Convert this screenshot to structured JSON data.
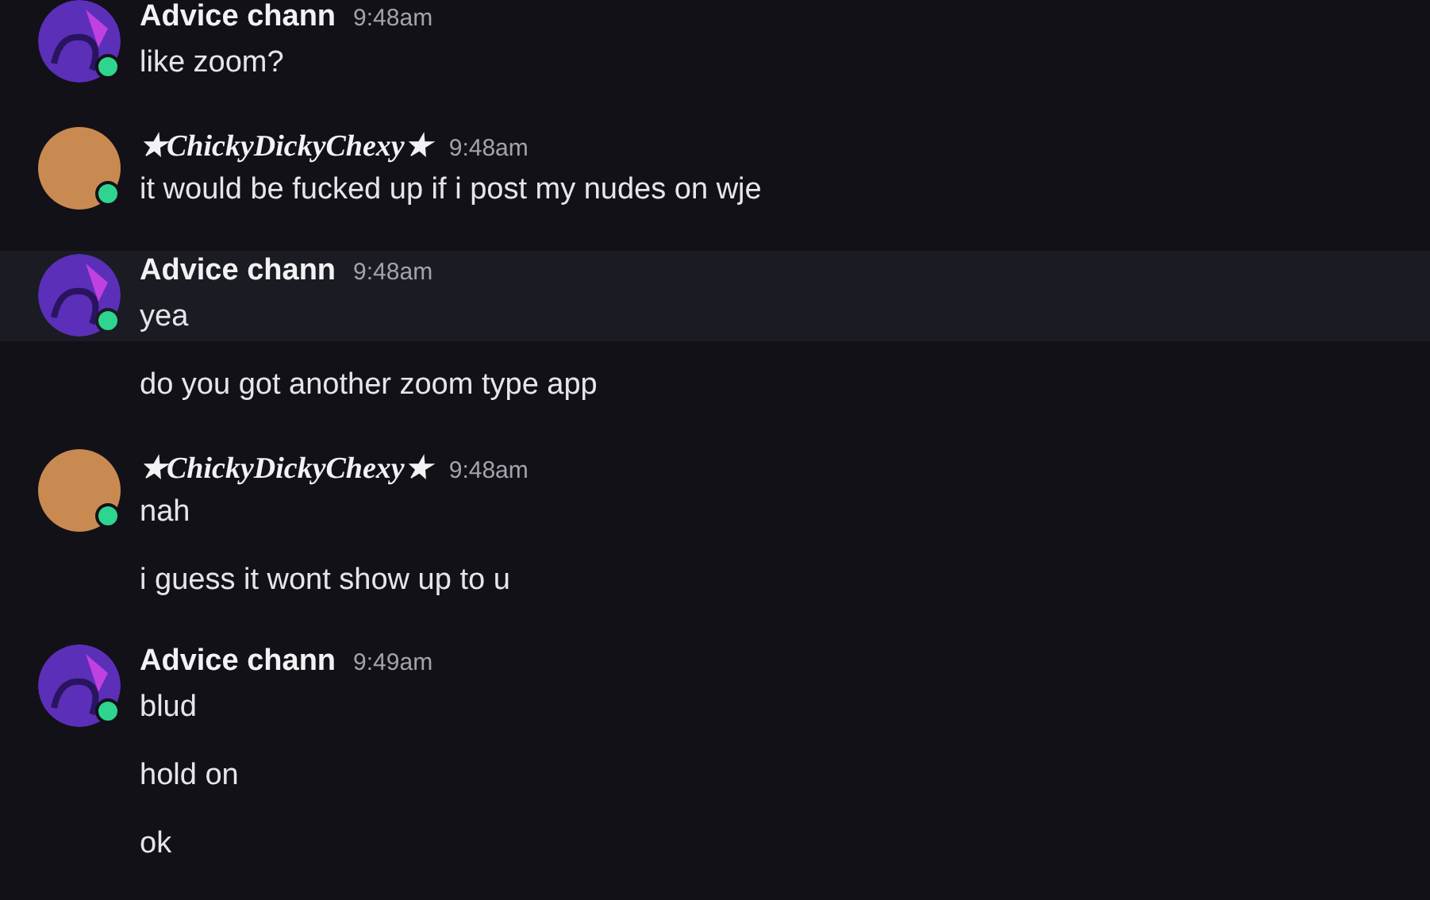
{
  "groups": [
    {
      "author": {
        "text": "Advice chann",
        "kind": "plain"
      },
      "avatar": {
        "kind": "drawing"
      },
      "online": true,
      "time": "9:48am",
      "messages": [
        {
          "text": "like zoom?",
          "highlighted": false
        }
      ]
    },
    {
      "author": {
        "text": "★ChickyDickyChexy★",
        "kind": "script"
      },
      "avatar": {
        "kind": "photo"
      },
      "online": true,
      "time": "9:48am",
      "messages": [
        {
          "text": "it would be fucked up if i post my nudes on wje",
          "highlighted": false
        }
      ]
    },
    {
      "author": {
        "text": "Advice chann",
        "kind": "plain"
      },
      "avatar": {
        "kind": "drawing"
      },
      "online": true,
      "time": "9:48am",
      "messages": [
        {
          "text": "yea",
          "highlighted": true
        },
        {
          "text": "do you got another zoom type app",
          "highlighted": false
        }
      ]
    },
    {
      "author": {
        "text": "★ChickyDickyChexy★",
        "kind": "script"
      },
      "avatar": {
        "kind": "photo"
      },
      "online": true,
      "time": "9:48am",
      "messages": [
        {
          "text": "nah",
          "highlighted": false
        },
        {
          "text": "i guess it wont show up to u",
          "highlighted": false
        }
      ]
    },
    {
      "author": {
        "text": "Advice chann",
        "kind": "plain"
      },
      "avatar": {
        "kind": "drawing"
      },
      "online": true,
      "time": "9:49am",
      "messages": [
        {
          "text": "blud",
          "highlighted": false
        },
        {
          "text": "hold on",
          "highlighted": false
        },
        {
          "text": "ok",
          "highlighted": false
        }
      ]
    }
  ]
}
